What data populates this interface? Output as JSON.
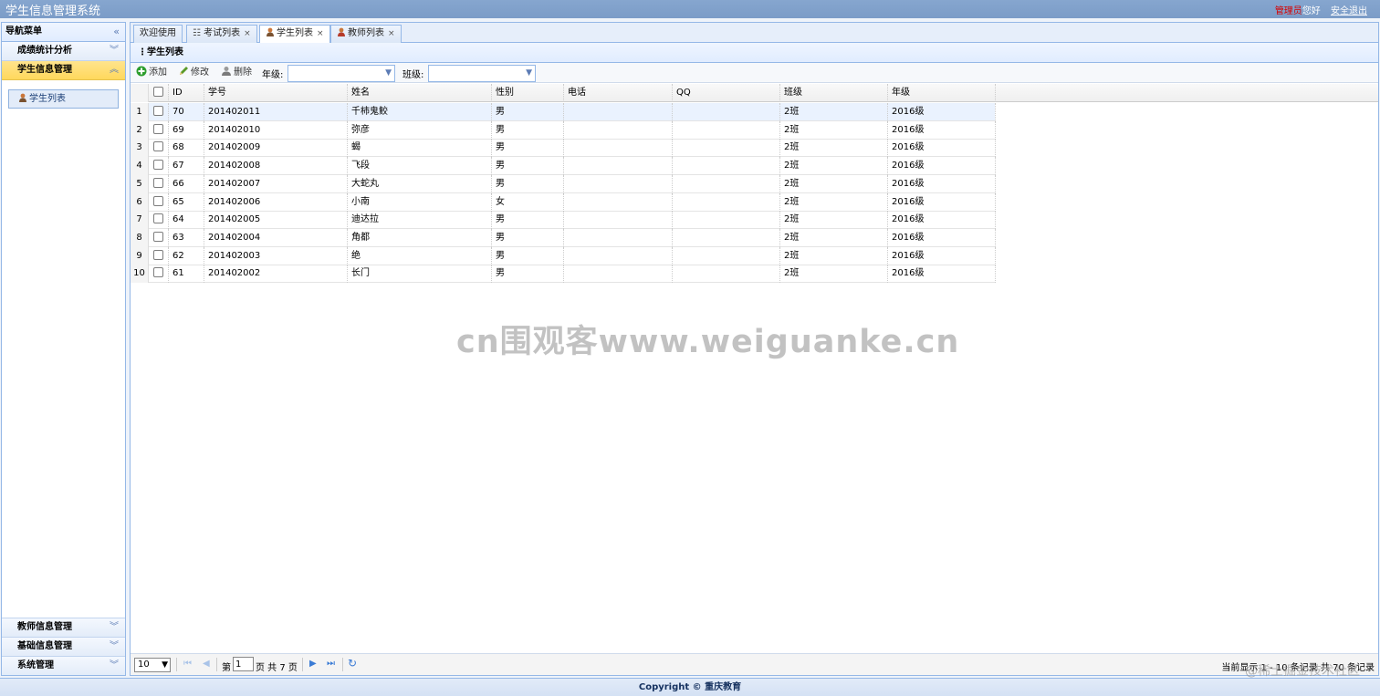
{
  "header": {
    "title": "学生信息管理系统",
    "role": "管理员",
    "greeting": "您好",
    "logout": "安全退出"
  },
  "sidebar": {
    "title": "导航菜单",
    "sections": [
      {
        "label": "成绩统计分析",
        "expanded": false
      },
      {
        "label": "学生信息管理",
        "expanded": true,
        "items": [
          {
            "label": "学生列表"
          }
        ]
      },
      {
        "label": "教师信息管理",
        "expanded": false
      },
      {
        "label": "基础信息管理",
        "expanded": false
      },
      {
        "label": "系统管理",
        "expanded": false
      }
    ]
  },
  "tabs": [
    {
      "label": "欢迎使用",
      "closable": false,
      "icon": "none"
    },
    {
      "label": "考试列表",
      "closable": true,
      "icon": "list-icon"
    },
    {
      "label": "学生列表",
      "closable": true,
      "icon": "student-icon",
      "active": true
    },
    {
      "label": "教师列表",
      "closable": true,
      "icon": "teacher-icon"
    }
  ],
  "panel": {
    "title": "学生列表"
  },
  "toolbar": {
    "add": "添加",
    "edit": "修改",
    "delete": "删除",
    "grade_label": "年级:",
    "grade_value": "",
    "class_label": "班级:",
    "class_value": ""
  },
  "grid": {
    "columns": [
      "ID",
      "学号",
      "姓名",
      "性别",
      "电话",
      "QQ",
      "班级",
      "年级"
    ],
    "rows": [
      {
        "n": "1",
        "id": "70",
        "sno": "201402011",
        "name": "千柿鬼鲛",
        "sex": "男",
        "phone": "",
        "qq": "",
        "cls": "2班",
        "grade": "2016级"
      },
      {
        "n": "2",
        "id": "69",
        "sno": "201402010",
        "name": "弥彦",
        "sex": "男",
        "phone": "",
        "qq": "",
        "cls": "2班",
        "grade": "2016级"
      },
      {
        "n": "3",
        "id": "68",
        "sno": "201402009",
        "name": "蝎",
        "sex": "男",
        "phone": "",
        "qq": "",
        "cls": "2班",
        "grade": "2016级"
      },
      {
        "n": "4",
        "id": "67",
        "sno": "201402008",
        "name": "飞段",
        "sex": "男",
        "phone": "",
        "qq": "",
        "cls": "2班",
        "grade": "2016级"
      },
      {
        "n": "5",
        "id": "66",
        "sno": "201402007",
        "name": "大蛇丸",
        "sex": "男",
        "phone": "",
        "qq": "",
        "cls": "2班",
        "grade": "2016级"
      },
      {
        "n": "6",
        "id": "65",
        "sno": "201402006",
        "name": "小南",
        "sex": "女",
        "phone": "",
        "qq": "",
        "cls": "2班",
        "grade": "2016级"
      },
      {
        "n": "7",
        "id": "64",
        "sno": "201402005",
        "name": "迪达拉",
        "sex": "男",
        "phone": "",
        "qq": "",
        "cls": "2班",
        "grade": "2016级"
      },
      {
        "n": "8",
        "id": "63",
        "sno": "201402004",
        "name": "角都",
        "sex": "男",
        "phone": "",
        "qq": "",
        "cls": "2班",
        "grade": "2016级"
      },
      {
        "n": "9",
        "id": "62",
        "sno": "201402003",
        "name": "绝",
        "sex": "男",
        "phone": "",
        "qq": "",
        "cls": "2班",
        "grade": "2016级"
      },
      {
        "n": "10",
        "id": "61",
        "sno": "201402002",
        "name": "长门",
        "sex": "男",
        "phone": "",
        "qq": "",
        "cls": "2班",
        "grade": "2016级"
      }
    ]
  },
  "pager": {
    "page_size": "10",
    "page_prefix": "第",
    "page": "1",
    "page_suffix": "页 共 7 页",
    "info": "当前显示 1 - 10 条记录 共 70 条记录"
  },
  "footer": {
    "copyright": "Copyright © 重庆教育"
  },
  "watermarks": {
    "center": "cn围观客www.weiguanke.cn",
    "corner": "@稀土掘金技术社区"
  },
  "colors": {
    "accent": "#95b8e7",
    "active_section": "#ffd85c",
    "role": "#d60000"
  }
}
